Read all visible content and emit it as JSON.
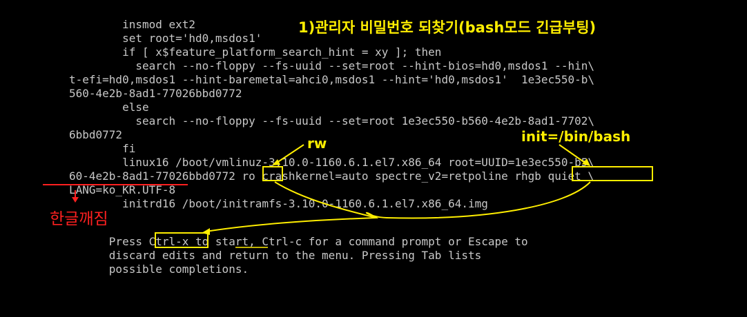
{
  "terminal": {
    "lines": [
      "        insmod ext2",
      "        set root='hd0,msdos1'",
      "        if [ x$feature_platform_search_hint = xy ]; then",
      "          search --no-floppy --fs-uuid --set=root --hint-bios=hd0,msdos1 --hin\\",
      "t-efi=hd0,msdos1 --hint-baremetal=ahci0,msdos1 --hint='hd0,msdos1'  1e3ec550-b\\",
      "560-4e2b-8ad1-77026bbd0772",
      "        else",
      "          search --no-floppy --fs-uuid --set=root 1e3ec550-b560-4e2b-8ad1-7702\\",
      "6bbd0772",
      "        fi",
      "        linux16 /boot/vmlinuz-3.10.0-1160.6.1.el7.x86_64 root=UUID=1e3ec550-b5\\",
      "60-4e2b-8ad1-77026bbd0772 ro crashkernel=auto spectre_v2=retpoline rhgb quiet \\",
      "LANG=ko_KR.UTF-8",
      "        initrd16 /boot/initramfs-3.10.0-1160.6.1.el7.x86_64.img",
      "",
      "      Press Ctrl-x to start, Ctrl-c for a command prompt or Escape to",
      "      discard edits and return to the menu. Pressing Tab lists",
      "      possible completions."
    ]
  },
  "annotations": {
    "title": "1)관리자 비밀번호 되찾기(bash모드 긴급부팅)",
    "rw": "rw",
    "init": "init=/bin/bash",
    "hangul": "한글깨짐"
  },
  "colors": {
    "background": "#000000",
    "terminal_text": "#c8c8c8",
    "highlight": "#ffee00",
    "warning": "#ff2020"
  }
}
